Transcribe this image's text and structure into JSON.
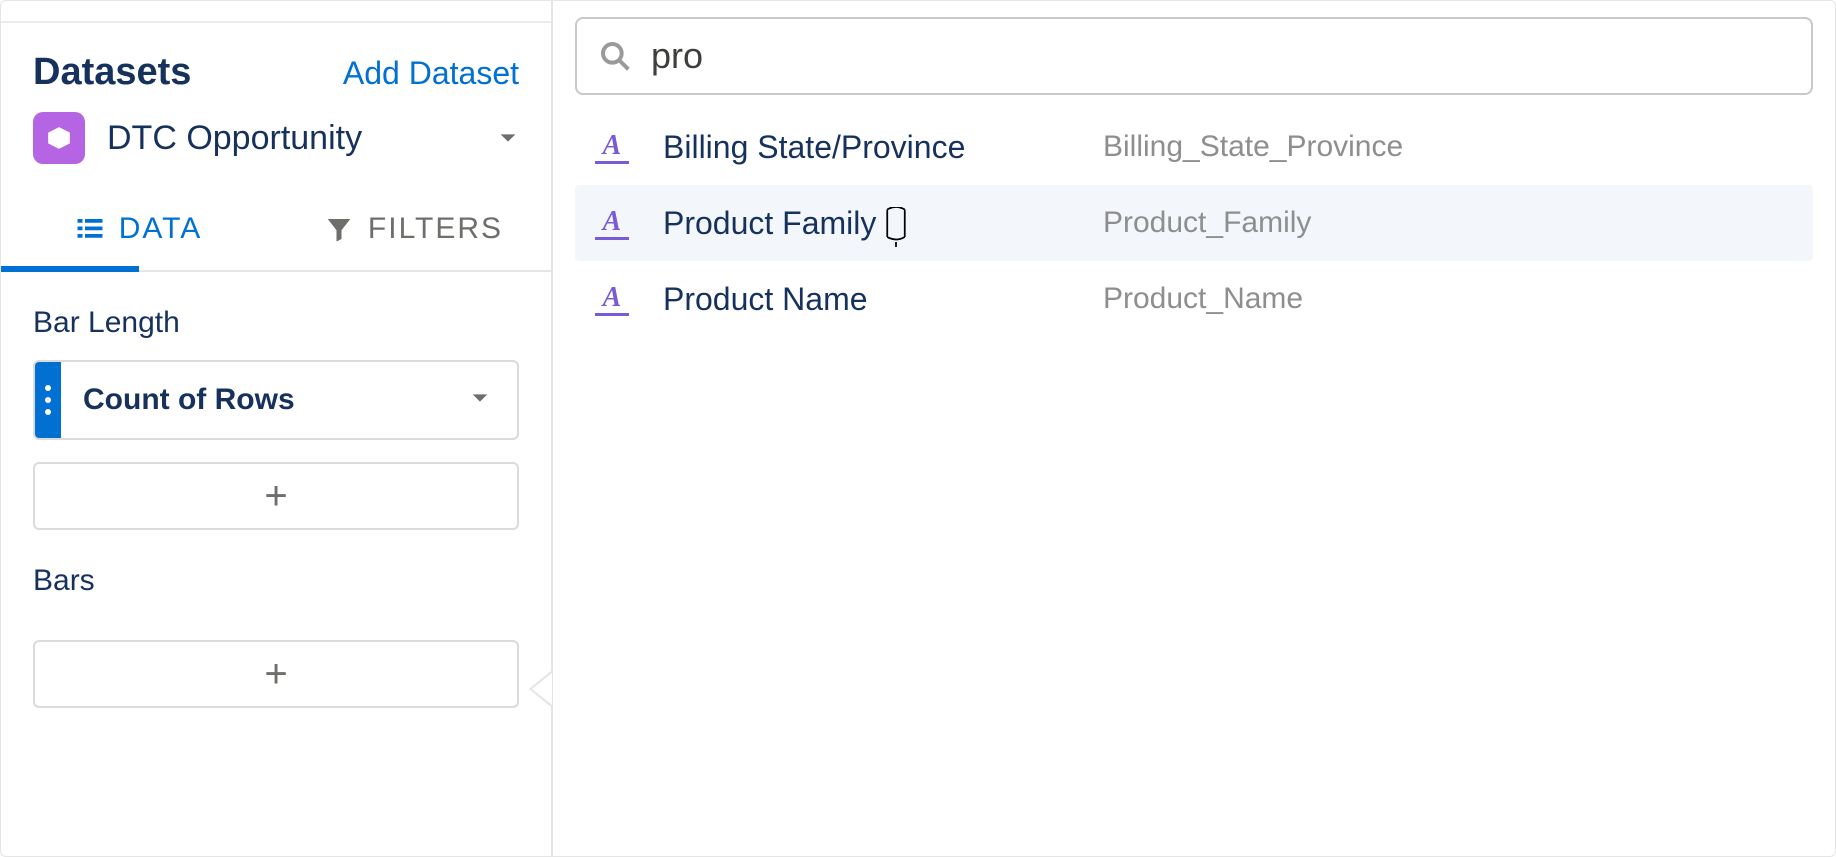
{
  "sidebar": {
    "datasets_title": "Datasets",
    "add_dataset": "Add Dataset",
    "selected_dataset": "DTC Opportunity",
    "tabs": {
      "data": "DATA",
      "filters": "FILTERS"
    },
    "sections": {
      "bar_length": {
        "label": "Bar Length",
        "field": "Count of Rows"
      },
      "bars": {
        "label": "Bars"
      }
    },
    "plus": "+"
  },
  "search": {
    "value": "pro"
  },
  "results": [
    {
      "label": "Billing State/Province",
      "api": "Billing_State_Province",
      "hovered": false
    },
    {
      "label": "Product Family",
      "api": "Product_Family",
      "hovered": true
    },
    {
      "label": "Product Name",
      "api": "Product_Name",
      "hovered": false
    }
  ],
  "icons": {
    "type_letter": "A"
  }
}
